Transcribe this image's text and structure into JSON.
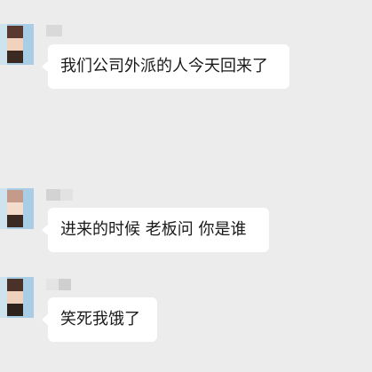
{
  "messages": [
    {
      "sender": "blurred",
      "text": "我们公司外派的人今天回来了"
    },
    {
      "sender": "blurred",
      "text": "进来的时候 老板问  你是谁"
    },
    {
      "sender": "blurred",
      "text": "笑死我饿了"
    }
  ],
  "colors": {
    "background": "#ececec",
    "bubble": "#ffffff",
    "text": "#1a1a1a"
  }
}
